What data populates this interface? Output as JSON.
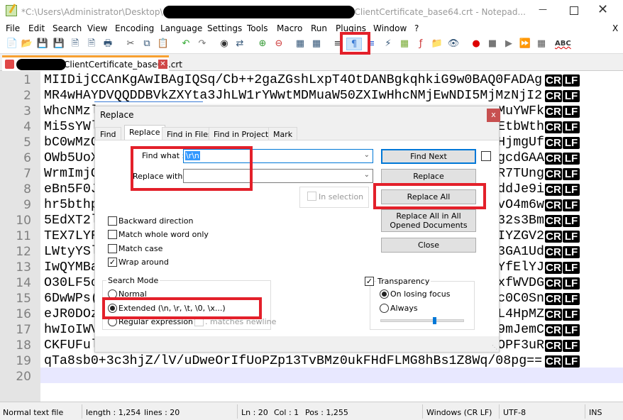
{
  "window": {
    "title_prefix": "*C:\\Users\\Administrator\\Desktop\\",
    "title_suffix": "ClientCertificate_base64.crt - Notepad...",
    "minimize_icon": "minimize-icon",
    "maximize_icon": "maximize-icon",
    "close_icon": "close-icon"
  },
  "menu": [
    "File",
    "Edit",
    "Search",
    "View",
    "Encoding",
    "Language",
    "Settings",
    "Tools",
    "Macro",
    "Run",
    "Plugins",
    "Window",
    "?"
  ],
  "menu_close": "X",
  "toolbar": {
    "icons": [
      "new-file",
      "open-file",
      "save",
      "save-all",
      "close",
      "close-all",
      "print",
      "cut",
      "copy",
      "paste",
      "undo",
      "redo",
      "find",
      "replace",
      "zoom-in",
      "zoom-out",
      "sync-vertical",
      "sync-horizontal",
      "word-wrap",
      "show-all-characters",
      "indent-guide",
      "user-defined-language",
      "doc-map",
      "function-list",
      "folder-as-workspace",
      "monitoring",
      "record-macro",
      "stop-macro",
      "play-macro",
      "run-macro-multiple",
      "save-macro",
      "spell-check"
    ],
    "active": "show-all-characters",
    "spell_label": "ABC"
  },
  "tab": {
    "label": "ClientCertificate_base64.crt"
  },
  "editor": {
    "line_numbers": [
      "1",
      "2",
      "3",
      "4",
      "5",
      "6",
      "7",
      "8",
      "9",
      "10",
      "11",
      "12",
      "13",
      "14",
      "15",
      "16",
      "17",
      "18",
      "19",
      "20"
    ],
    "full_lines": {
      "1": "MIIDijCCAnKgAwIBAgIQSq/Cb++2gaZGshLxpT4OtDANBgkqhkiG9w0BAQ0FADAg",
      "2": "MR4wHAYDVQQDDBVkZXYta3JhLW1rYWwtMDMuaW50ZXIwHhcNMjEwNDI5MjMzNjI2",
      "19": "qTa8sb0+3c3hjZ/lV/uDweOrIfUoPZp13TvBMz0ukFHdFLMG8hBs1Z8Wq/08pg=="
    },
    "partial_lines": [
      {
        "start": "WhcNMzl",
        "end": "MuYWFk"
      },
      {
        "start": "Mi5sYWl",
        "end": "EtbWth"
      },
      {
        "start": "bC0wMzO",
        "end": "HjmgUf"
      },
      {
        "start": "OWb5UoX",
        "end": "gcdGAA"
      },
      {
        "start": "WrmImjO",
        "end": "R7TUng"
      },
      {
        "start": "eBn5F0J",
        "end": "ddJe9i"
      },
      {
        "start": "hr5bthp",
        "end": "vO4m6w"
      },
      {
        "start": "5EdXT2l",
        "end": "32s3Bm"
      },
      {
        "start": "TEX7LYF",
        "end": "IYZGV2"
      },
      {
        "start": "LWtyYSl",
        "end": "3GA1Ud"
      },
      {
        "start": "IwQYMBa",
        "end": "YfElYJ"
      },
      {
        "start": "O30LF5c",
        "end": "xfWVDG"
      },
      {
        "start": "6DwWPs(",
        "end": "c0C0Sn"
      },
      {
        "start": "eJR0DOz",
        "end": "L4HpMZ"
      },
      {
        "start": "hwIoIWV",
        "end": "9mJemC"
      },
      {
        "start": "CKFUFul",
        "end": "OPF3uR"
      }
    ],
    "cr": "CR",
    "lf": "LF"
  },
  "dialog": {
    "title": "Replace",
    "close": "x",
    "tabs": [
      "Find",
      "Replace",
      "Find in Files",
      "Find in Projects",
      "Mark"
    ],
    "active_tab": "Replace",
    "find_what_label": "Find what :",
    "find_what_value": "\\r\\n",
    "replace_with_label": "Replace with :",
    "replace_with_value": "",
    "in_selection": "In selection",
    "buttons": {
      "find_next": "Find Next",
      "replace": "Replace",
      "replace_all": "Replace All",
      "replace_all_opened": "Replace All in All Opened Documents",
      "close": "Close"
    },
    "options": [
      {
        "label": "Backward direction",
        "checked": false
      },
      {
        "label": "Match whole word only",
        "checked": false
      },
      {
        "label": "Match case",
        "checked": false
      },
      {
        "label": "Wrap around",
        "checked": true
      }
    ],
    "search_mode": {
      "title": "Search Mode",
      "options": [
        "Normal",
        "Extended (\\n, \\r, \\t, \\0, \\x...)",
        "Regular expression"
      ],
      "selected": "Extended (\\n, \\r, \\t, \\0, \\x...)",
      "matches_newline": ". matches newline"
    },
    "transparency": {
      "label": "Transparency",
      "checked": true,
      "options": [
        "On losing focus",
        "Always"
      ],
      "selected": "On losing focus",
      "level": 0.65
    }
  },
  "status": {
    "type": "Normal text file",
    "length": "length : 1,254",
    "lines": "lines : 20",
    "ln": "Ln : 20",
    "col": "Col : 1",
    "pos": "Pos : 1,255",
    "eol": "Windows (CR LF)",
    "encoding": "UTF-8",
    "mode": "INS"
  },
  "annotation_color": "#e3202a"
}
